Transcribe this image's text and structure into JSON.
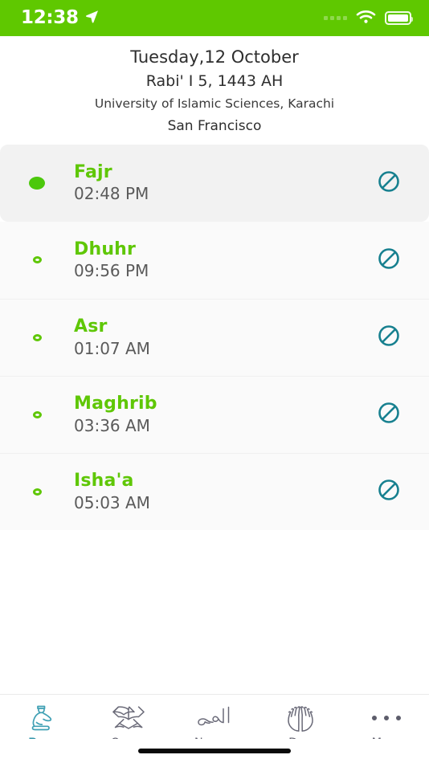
{
  "status_bar": {
    "time": "12:38",
    "location_icon": "location-arrow-icon",
    "signal_icon": "signal-dots-icon",
    "wifi_icon": "wifi-icon",
    "battery_icon": "battery-full-icon",
    "background_color": "#5FC800"
  },
  "header": {
    "gregorian_date": "Tuesday,12 October",
    "hijri_date": "Rabi' I 5, 1443 AH",
    "calculation_method": "University of Islamic Sciences, Karachi",
    "city": "San Francisco"
  },
  "prayers": [
    {
      "name": "Fajr",
      "time": "02:48 PM",
      "active": true,
      "indicator": "filled-dot",
      "alert_icon": "mute-off-icon"
    },
    {
      "name": "Dhuhr",
      "time": "09:56 PM",
      "active": false,
      "indicator": "hollow-dot",
      "alert_icon": "mute-off-icon"
    },
    {
      "name": "Asr",
      "time": "01:07 AM",
      "active": false,
      "indicator": "hollow-dot",
      "alert_icon": "mute-off-icon"
    },
    {
      "name": "Maghrib",
      "time": "03:36 AM",
      "active": false,
      "indicator": "hollow-dot",
      "alert_icon": "mute-off-icon"
    },
    {
      "name": "Isha'a",
      "time": "05:03 AM",
      "active": false,
      "indicator": "hollow-dot",
      "alert_icon": "mute-off-icon"
    }
  ],
  "tabs": [
    {
      "label": "Pray",
      "icon": "praying-person-icon",
      "active": true
    },
    {
      "label": "Quran",
      "icon": "open-book-icon",
      "active": false
    },
    {
      "label": "Names",
      "icon": "allah-calligraphy-icon",
      "active": false
    },
    {
      "label": "Dua",
      "icon": "open-hands-icon",
      "active": false
    },
    {
      "label": "More",
      "icon": "three-dots-icon",
      "active": false
    }
  ],
  "colors": {
    "brand_green": "#5FC800",
    "prayer_green": "#5FC706",
    "accent_teal": "#2F93A8",
    "active_row_bg": "#F2F2F2",
    "row_bg": "#FAFAFA"
  }
}
